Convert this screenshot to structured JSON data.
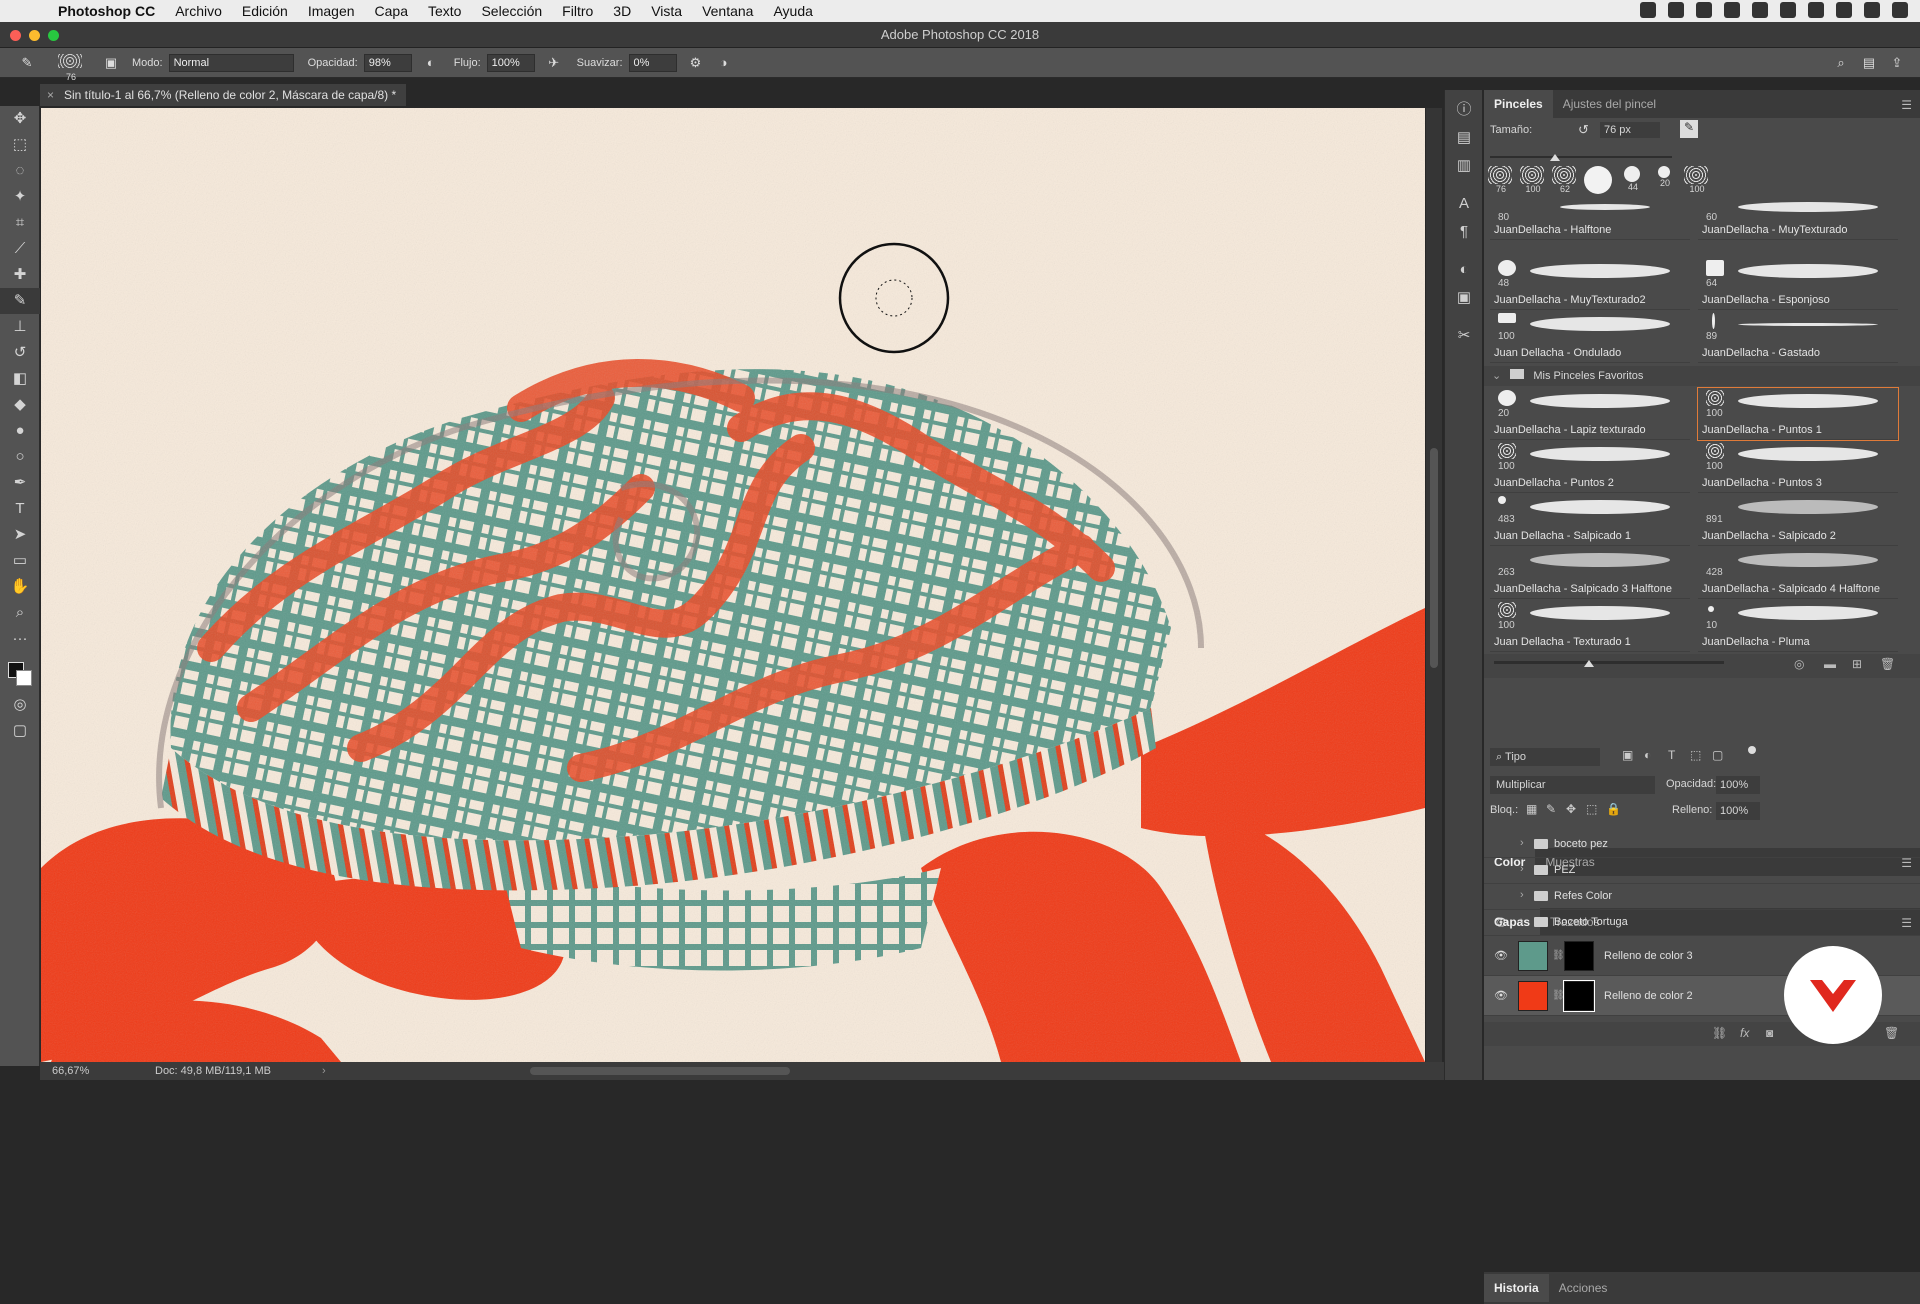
{
  "menubar": {
    "app": "Photoshop CC",
    "items": [
      "Archivo",
      "Edición",
      "Imagen",
      "Capa",
      "Texto",
      "Selección",
      "Filtro",
      "3D",
      "Vista",
      "Ventana",
      "Ayuda"
    ]
  },
  "window": {
    "title": "Adobe Photoshop CC 2018"
  },
  "options": {
    "brush_size": "76",
    "mode_label": "Modo:",
    "mode_value": "Normal",
    "opacity_label": "Opacidad:",
    "opacity_value": "98%",
    "flow_label": "Flujo:",
    "flow_value": "100%",
    "smooth_label": "Suavizar:",
    "smooth_value": "0%"
  },
  "document": {
    "tab_title": "Sin título-1 al 66,7% (Relleno de color 2, Máscara de capa/8) *"
  },
  "status": {
    "zoom": "66,67%",
    "doc_info": "Doc: 49,8 MB/119,1 MB"
  },
  "brushes_panel": {
    "tabs": [
      "Pinceles",
      "Ajustes del pincel"
    ],
    "size_label": "Tamaño:",
    "size_value": "76 px",
    "presets": [
      "76",
      "100",
      "62",
      "",
      "44",
      "20",
      "100"
    ],
    "cells": [
      {
        "num": "80",
        "name": "JuanDellacha - Halftone"
      },
      {
        "num": "60",
        "name": "JuanDellacha - MuyTexturado"
      },
      {
        "num": "48",
        "name": "JuanDellacha - MuyTexturado2"
      },
      {
        "num": "64",
        "name": "JuanDellacha - Esponjoso"
      },
      {
        "num": "100",
        "name": "Juan Dellacha - Ondulado"
      },
      {
        "num": "89",
        "name": "JuanDellacha - Gastado"
      }
    ],
    "folder_name": "Mis Pinceles Favoritos",
    "fav_cells": [
      {
        "num": "20",
        "name": "JuanDellacha - Lapiz texturado"
      },
      {
        "num": "100",
        "name": "JuanDellacha - Puntos 1"
      },
      {
        "num": "100",
        "name": "JuanDellacha - Puntos 2"
      },
      {
        "num": "100",
        "name": "JuanDellacha - Puntos 3"
      },
      {
        "num": "483",
        "name": "Juan Dellacha - Salpicado 1"
      },
      {
        "num": "891",
        "name": "JuanDellacha - Salpicado 2"
      },
      {
        "num": "263",
        "name": "JuanDellacha - Salpicado 3 Halftone"
      },
      {
        "num": "428",
        "name": "JuanDellacha - Salpicado 4 Halftone"
      },
      {
        "num": "100",
        "name": "Juan Dellacha - Texturado 1"
      },
      {
        "num": "10",
        "name": "JuanDellacha - Pluma"
      }
    ]
  },
  "color_panel": {
    "tabs": [
      "Color",
      "Muestras"
    ]
  },
  "layers_panel": {
    "tabs": [
      "Capas",
      "Trazados"
    ],
    "filter": "Tipo",
    "blend_mode": "Multiplicar",
    "opacity_label": "Opacidad:",
    "opacity_value": "100%",
    "lock_label": "Bloq.:",
    "fill_label": "Relleno:",
    "fill_value": "100%",
    "groups": [
      "boceto pez",
      "PEZ",
      "Refes Color",
      "Boceto Tortuga"
    ],
    "fill_layers": [
      {
        "name": "Relleno de color 3",
        "color": "#5e9a8b"
      },
      {
        "name": "Relleno de color 2",
        "color": "#f03a17"
      }
    ]
  },
  "history_panel": {
    "tabs": [
      "Historia",
      "Acciones"
    ]
  },
  "colors": {
    "canvas_bg": "#f7eadb",
    "shell_red": "#ea4a25",
    "shell_teal": "#5e9a8b",
    "body_red": "#f03a17",
    "accent_orange": "#e07b39"
  }
}
